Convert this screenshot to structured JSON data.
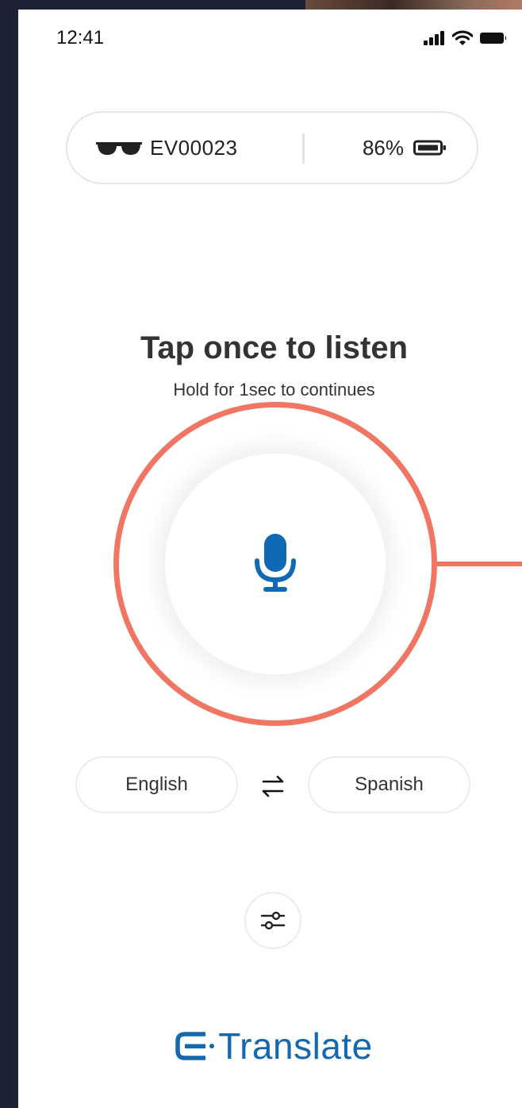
{
  "status_bar": {
    "time": "12:41"
  },
  "device": {
    "name": "EV00023",
    "battery": "86%"
  },
  "prompt": {
    "title": "Tap once to listen",
    "subtitle": "Hold for 1sec to continues"
  },
  "languages": {
    "source": "English",
    "target": "Spanish"
  },
  "brand": {
    "name": "Translate"
  },
  "colors": {
    "accent_ring": "#f07663",
    "brand_blue": "#1468b0",
    "mic_blue": "#0f69b4",
    "text_dark": "#333333"
  },
  "icons": {
    "device": "sunglasses-icon",
    "battery": "battery-icon",
    "mic": "microphone-icon",
    "swap": "swap-arrows-icon",
    "settings": "sliders-icon",
    "logo": "e-logo-icon"
  }
}
